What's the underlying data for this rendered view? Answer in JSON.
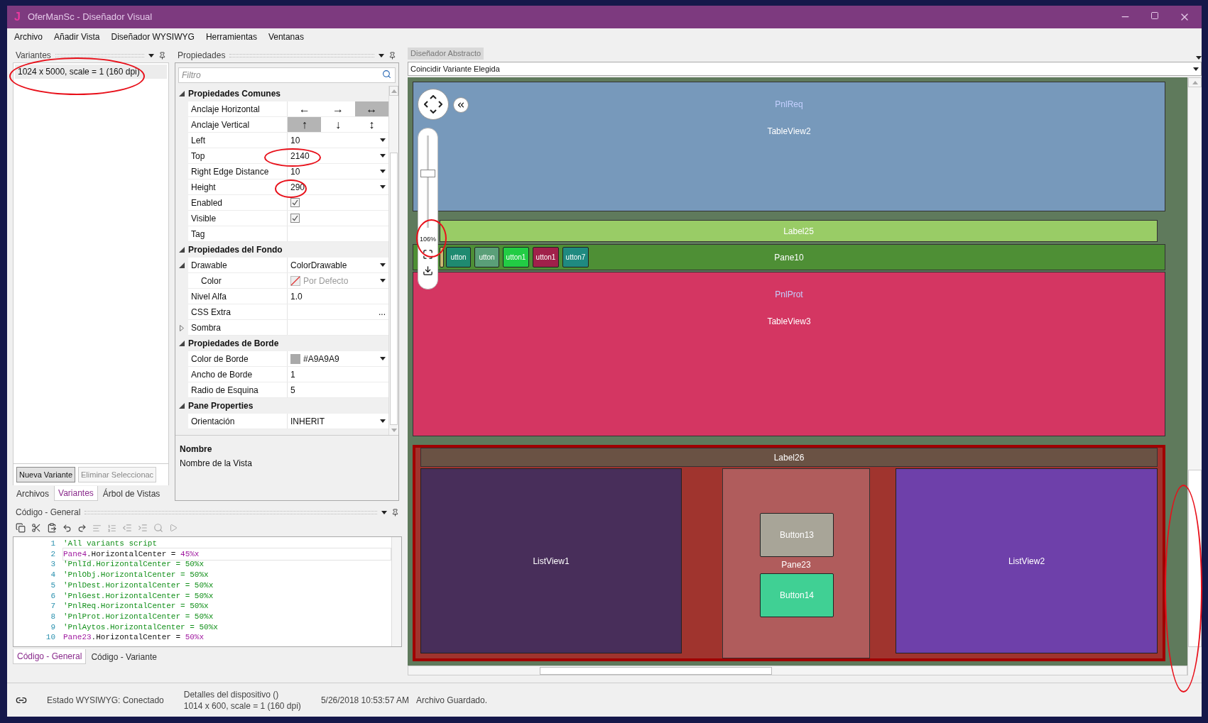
{
  "window": {
    "logo": "J",
    "title": "OferManSc - Diseñador Visual"
  },
  "menu": [
    "Archivo",
    "Añadir Vista",
    "Diseñador WYSIWYG",
    "Herramientas",
    "Ventanas"
  ],
  "variants_panel": {
    "title": "Variantes",
    "items": [
      {
        "label": "1024 x 5000, scale = 1 (160 dpi)",
        "selected": true
      }
    ],
    "buttons": [
      {
        "label": "Nueva Variante",
        "disabled": false
      },
      {
        "label": "Eliminar Seleccionac",
        "disabled": true
      }
    ]
  },
  "left_tabs": [
    {
      "label": "Archivos",
      "selected": false
    },
    {
      "label": "Variantes",
      "selected": true
    },
    {
      "label": "Árbol de Vistas",
      "selected": false
    }
  ],
  "properties": {
    "title": "Propiedades",
    "filter_placeholder": "Filtro",
    "sections": [
      {
        "title": "Propiedades Comunes",
        "expanded": true,
        "rows": [
          {
            "kind": "anchor",
            "label": "Anclaje Horizontal",
            "options": [
              {
                "glyph": "←",
                "selected": false
              },
              {
                "glyph": "→",
                "selected": false
              },
              {
                "glyph": "↔",
                "selected": true
              }
            ]
          },
          {
            "kind": "anchor",
            "label": "Anclaje Vertical",
            "options": [
              {
                "glyph": "↑",
                "selected": true
              },
              {
                "glyph": "↓",
                "selected": false
              },
              {
                "glyph": "↕",
                "selected": false
              }
            ]
          },
          {
            "kind": "dropdown",
            "label": "Left",
            "value": "10"
          },
          {
            "kind": "dropdown",
            "label": "Top",
            "value": "2140"
          },
          {
            "kind": "dropdown",
            "label": "Right Edge Distance",
            "value": "10"
          },
          {
            "kind": "dropdown",
            "label": "Height",
            "value": "290"
          },
          {
            "kind": "checkbox",
            "label": "Enabled",
            "checked": true
          },
          {
            "kind": "checkbox",
            "label": "Visible",
            "checked": true
          },
          {
            "kind": "text",
            "label": "Tag"
          }
        ]
      },
      {
        "title": "Propiedades del Fondo",
        "expanded": true,
        "rows": [
          {
            "kind": "dropdown",
            "label": "Drawable",
            "value": "ColorDrawable",
            "expanded": true,
            "children": [
              {
                "kind": "color",
                "label": "Color",
                "value": "Por Defecto"
              }
            ]
          },
          {
            "kind": "text",
            "label": "Nivel Alfa",
            "value": "1.0"
          },
          {
            "kind": "ellipsis",
            "label": "CSS Extra",
            "button": "..."
          },
          {
            "kind": "group",
            "label": "Sombra",
            "expanded": false
          }
        ]
      },
      {
        "title": "Propiedades de Borde",
        "expanded": true,
        "rows": [
          {
            "kind": "color",
            "label": "Color de Borde",
            "value": "#A9A9A9",
            "color": "#a9a9a9"
          },
          {
            "kind": "text",
            "label": "Ancho de Borde",
            "value": "1"
          },
          {
            "kind": "text",
            "label": "Radio de Esquina",
            "value": "5"
          }
        ]
      },
      {
        "title": "Pane Properties",
        "expanded": true,
        "rows": [
          {
            "kind": "dropdown",
            "label": "Orientación",
            "value": "INHERIT"
          }
        ]
      }
    ],
    "description": {
      "title": "Nombre",
      "text": "Nombre de la Vista"
    }
  },
  "code_panel": {
    "title": "Código - General",
    "lines": [
      {
        "number": "1",
        "selected": false,
        "parts": [
          {
            "kind": "comment",
            "text": "'All variants script"
          }
        ]
      },
      {
        "number": "2",
        "selected": true,
        "parts": [
          {
            "kind": "name",
            "text": "Pane4"
          },
          {
            "kind": "plain",
            "text": ".HorizontalCenter = "
          },
          {
            "kind": "name",
            "text": "45%x"
          }
        ]
      },
      {
        "number": "3",
        "selected": false,
        "parts": [
          {
            "kind": "comment",
            "text": "'PnlId.HorizontalCenter = 50%x"
          }
        ]
      },
      {
        "number": "4",
        "selected": false,
        "parts": [
          {
            "kind": "comment",
            "text": "'PnlObj.HorizontalCenter = 50%x"
          }
        ]
      },
      {
        "number": "5",
        "selected": false,
        "parts": [
          {
            "kind": "comment",
            "text": "'PnlDest.HorizontalCenter = 50%x"
          }
        ]
      },
      {
        "number": "6",
        "selected": false,
        "parts": [
          {
            "kind": "comment",
            "text": "'PnlGest.HorizontalCenter = 50%x"
          }
        ]
      },
      {
        "number": "7",
        "selected": false,
        "parts": [
          {
            "kind": "comment",
            "text": "'PnlReq.HorizontalCenter = 50%x"
          }
        ]
      },
      {
        "number": "8",
        "selected": false,
        "parts": [
          {
            "kind": "comment",
            "text": "'PnlProt.HorizontalCenter = 50%x"
          }
        ]
      },
      {
        "number": "9",
        "selected": false,
        "parts": [
          {
            "kind": "comment",
            "text": "'PnlAytos.HorizontalCenter = 50%x"
          }
        ]
      },
      {
        "number": "10",
        "selected": false,
        "parts": [
          {
            "kind": "name",
            "text": "Pane23"
          },
          {
            "kind": "plain",
            "text": ".HorizontalCenter = "
          },
          {
            "kind": "name",
            "text": "50%x"
          }
        ]
      }
    ],
    "tabs": [
      {
        "label": "Código - General",
        "selected": true
      },
      {
        "label": "Código - Variante",
        "selected": false
      }
    ]
  },
  "designer": {
    "tab": "Diseñador Abstracto",
    "mode": "Coincidir Variante Elegida",
    "zoom": {
      "reading": "106%",
      "level": 0.6
    },
    "items": [
      {
        "kind": "pane",
        "caption": "PnlReq",
        "label": "TableView2",
        "color": "#7799bb"
      },
      {
        "kind": "label",
        "label": "Label25",
        "color": "#99cc66"
      },
      {
        "kind": "pane",
        "color": "#4e8f35",
        "children": [
          {
            "kind": "button",
            "color": "#c8b870"
          },
          {
            "kind": "button",
            "label": "utton",
            "color": "#1f8a70"
          },
          {
            "kind": "button",
            "label": "utton",
            "color": "#5a9f78"
          },
          {
            "kind": "button",
            "label": "utton1",
            "color": "#22cc44"
          },
          {
            "kind": "button",
            "label": "utton1",
            "color": "#a0204a"
          },
          {
            "kind": "button",
            "label": "utton7",
            "color": "#1f8a80"
          }
        ],
        "label": "Pane10"
      },
      {
        "kind": "pane",
        "caption": "PnlProt",
        "label": "TableView3",
        "color": "#d43662"
      },
      {
        "kind": "frame",
        "color": "#a0342e",
        "children": [
          {
            "kind": "label",
            "label": "Label26",
            "color": "#6a5244"
          },
          {
            "kind": "list",
            "label": "ListView1",
            "color": "#482e5a"
          },
          {
            "kind": "pane",
            "color": "#b05c5c",
            "children": [
              {
                "kind": "button",
                "label": "Button13",
                "color": "#a8a598"
              },
              {
                "kind": "button",
                "label": "Button14",
                "color": "#40d094"
              }
            ],
            "label": "Pane23"
          },
          {
            "kind": "list",
            "label": "ListView2",
            "color": "#6e40aa"
          }
        ]
      }
    ]
  },
  "status_bar": {
    "connection": "Estado WYSIWYG: Conectado",
    "device_title": "Detalles del dispositivo ()",
    "device": "1014 x 600, scale = 1 (160 dpi)",
    "time": "5/26/2018 10:53:57 AM",
    "message": "Archivo Guardado."
  },
  "annotations": [
    {
      "kind": "ellipse"
    },
    {
      "kind": "ellipse"
    },
    {
      "kind": "ellipse"
    },
    {
      "kind": "ellipse"
    },
    {
      "kind": "ellipse"
    }
  ]
}
